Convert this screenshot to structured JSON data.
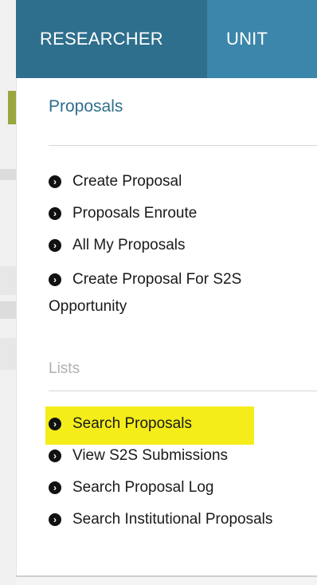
{
  "nav": {
    "tabs": [
      {
        "label": "RESEARCHER",
        "active": true
      },
      {
        "label": "UNIT",
        "active": false
      }
    ]
  },
  "menu": {
    "proposals_heading": "Proposals",
    "proposals_items": [
      {
        "label": "Create Proposal"
      },
      {
        "label": "Proposals Enroute"
      },
      {
        "label": "All My Proposals"
      },
      {
        "label": "Create Proposal For S2S Opportunity"
      }
    ],
    "lists_heading": "Lists",
    "lists_items": [
      {
        "label": "Search Proposals",
        "highlighted": true
      },
      {
        "label": "View S2S Submissions"
      },
      {
        "label": "Search Proposal Log"
      },
      {
        "label": "Search Institutional Proposals"
      }
    ]
  },
  "colors": {
    "nav_active": "#2e6f8d",
    "nav_inactive": "#3b86aa",
    "heading": "#2e6f8d",
    "highlight": "#f4ed1a"
  },
  "icons": {
    "item_bullet": "circle-arrow-right-icon"
  }
}
